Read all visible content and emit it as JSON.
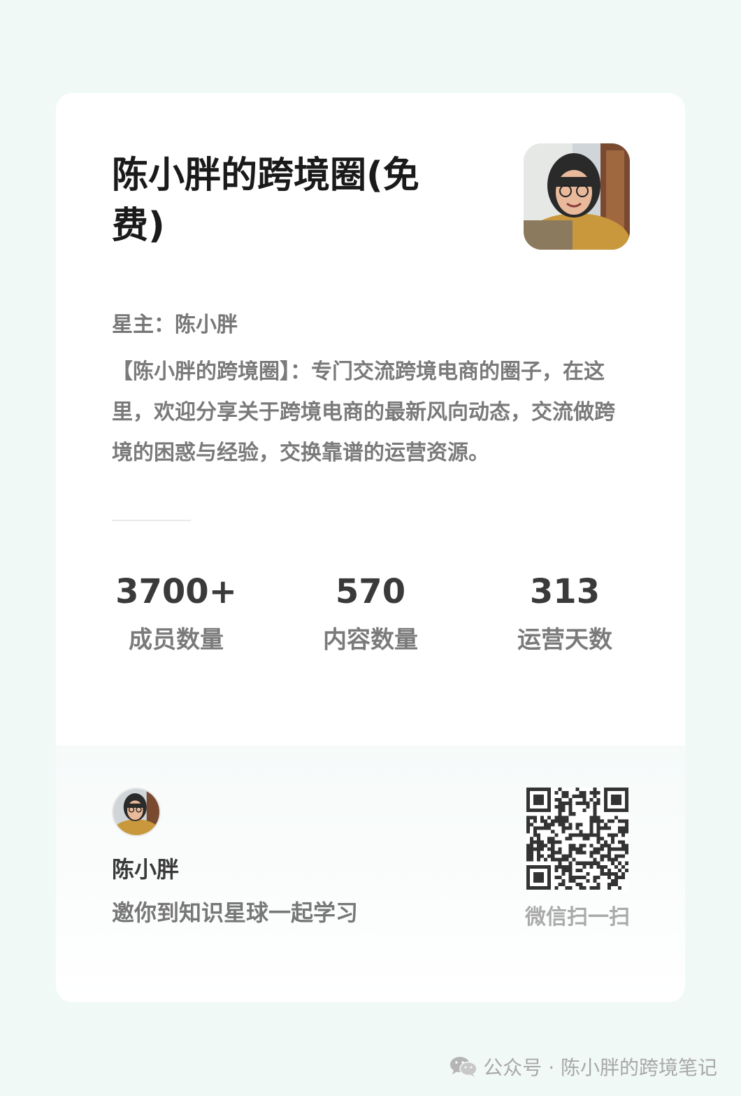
{
  "card": {
    "title": "陈小胖的跨境圈(免费)",
    "owner_line": "星主：陈小胖",
    "description": "【陈小胖的跨境圈】：专门交流跨境电商的圈子，在这里，欢迎分享关于跨境电商的最新风向动态，交流做跨境的困惑与经验，交换靠谱的运营资源。"
  },
  "stats": [
    {
      "value": "3700+",
      "label": "成员数量"
    },
    {
      "value": "570",
      "label": "内容数量"
    },
    {
      "value": "313",
      "label": "运营天数"
    }
  ],
  "footer": {
    "name": "陈小胖",
    "invite": "邀你到知识星球一起学习",
    "scan_label": "微信扫一扫"
  },
  "watermark": "公众号 · 陈小胖的跨境笔记",
  "icons": {
    "wechat": "wechat-icon",
    "qr": "qr-code"
  },
  "colors": {
    "page_bg": "#f1f9f6",
    "card_bg": "#ffffff",
    "title": "#1a1a1a",
    "muted": "#7a7a7a"
  }
}
